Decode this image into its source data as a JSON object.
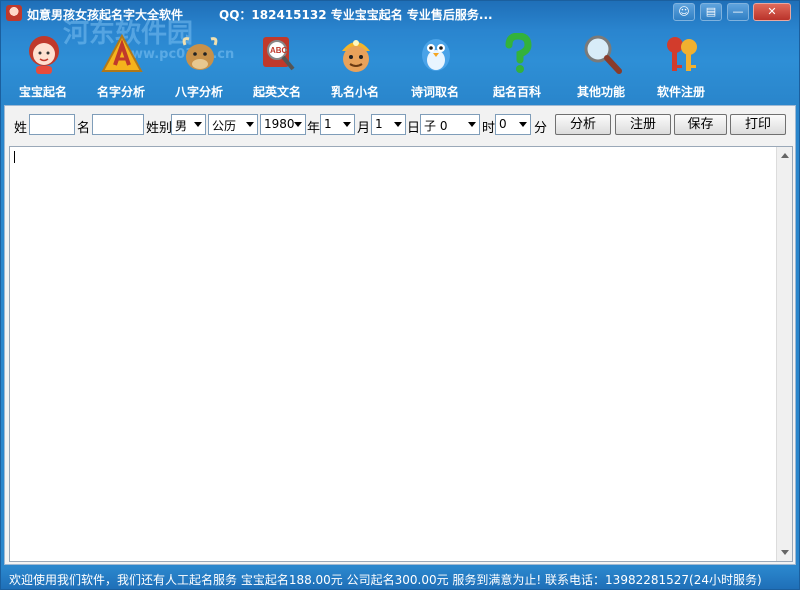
{
  "window": {
    "title": "如意男孩女孩起名字大全软件",
    "title_extra": "QQ：182415132  专业宝宝起名  专业售后服务...",
    "watermark": "河东软件园",
    "watermark_url": "www.pc0359.cn",
    "controls": {
      "skin": "☺",
      "menu": "▤",
      "minimize": "—",
      "close": "✕"
    }
  },
  "toolbar": {
    "items": [
      {
        "label": "宝宝起名",
        "icon": "baby-girl-icon",
        "color": "#d8403a"
      },
      {
        "label": "名字分析",
        "icon": "warning-triangle-icon",
        "color": "#f5b31c"
      },
      {
        "label": "八字分析",
        "icon": "ox-icon",
        "color": "#b8843a"
      },
      {
        "label": "起英文名",
        "icon": "abc-magnifier-icon",
        "color": "#c0392b"
      },
      {
        "label": "乳名小名",
        "icon": "miner-head-icon",
        "color": "#e8a25a"
      },
      {
        "label": "诗词取名",
        "icon": "bird-icon",
        "color": "#4aa3e8"
      },
      {
        "label": "起名百科",
        "icon": "question-mark-icon",
        "color": "#33b23b"
      },
      {
        "label": "其他功能",
        "icon": "magnifier-icon",
        "color": "#8a8a8a"
      },
      {
        "label": "软件注册",
        "icon": "keys-icon",
        "color": "#d23c2c"
      }
    ]
  },
  "form": {
    "surname_label": "姓",
    "surname_value": "",
    "name_label": "名",
    "name_value": "",
    "gender_label": "姓别",
    "gender_value": "男",
    "calendar_value": "公历",
    "year_value": "1980",
    "year_label": "年",
    "month_value": "1",
    "month_label": "月",
    "day_value": "1",
    "day_label": "日",
    "hour_value": "子 0",
    "hour_label": "时",
    "minute_value": "0",
    "minute_label": "分",
    "analyze_button": "分析",
    "register_button": "注册",
    "save_button": "保存",
    "print_button": "打印"
  },
  "output": {
    "text": ""
  },
  "status": {
    "text": "欢迎使用我们软件，我们还有人工起名服务  宝宝起名188.00元  公司起名300.00元  服务到满意为止!  联系电话：13982281527(24小时服务)"
  }
}
